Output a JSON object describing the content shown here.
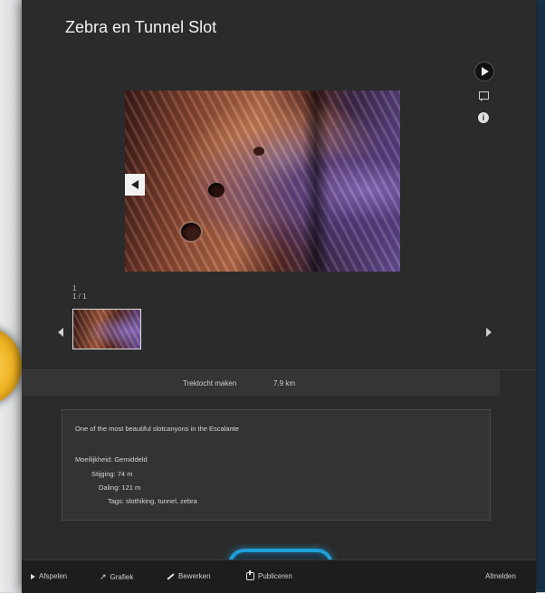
{
  "album": {
    "title": "Zebra en Tunnel Slot",
    "counter": "1 / 1",
    "counter_mark": "1"
  },
  "stats": {
    "label": "Trektocht maken",
    "value": "7.9 km"
  },
  "description": {
    "text": "One of the most beautiful slotcanyons in the Escalante",
    "difficulty": "Moeilijkheid: Gemiddeld",
    "ascent": "Stijging: 74 m",
    "descent": "Daling: 121 m",
    "tags": "Tags: slothiking, tunnel, zebra"
  },
  "bottombar": {
    "play": "Afspelen",
    "graphs": "Grafiek",
    "edit": "Bewerken",
    "publish": "Publiceren",
    "logout": "Afmelden"
  },
  "icons": {
    "slideshow": "play-icon",
    "comment": "comment-icon",
    "info": "info-icon"
  },
  "colors": {
    "panel": "#2b2b2b",
    "highlight": "#1f9fd8",
    "bar": "#1d1d1d"
  }
}
